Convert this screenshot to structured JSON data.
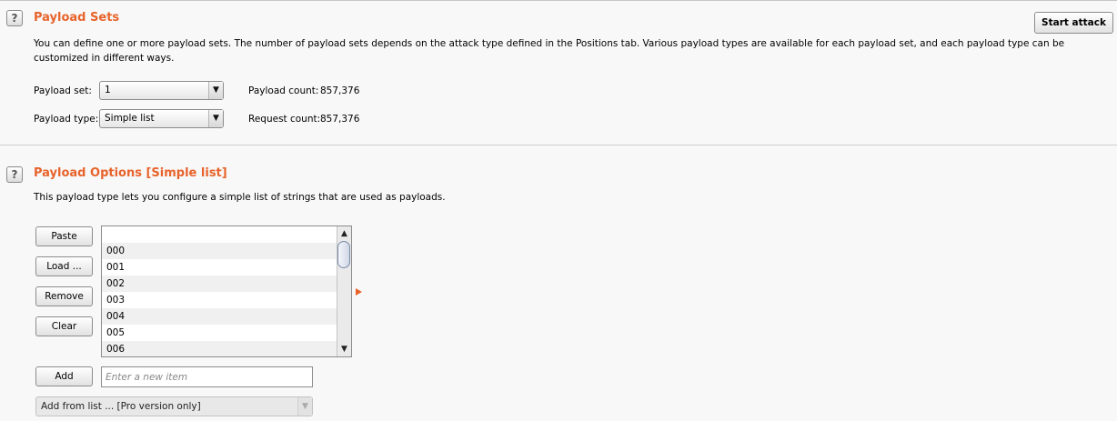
{
  "payload_sets": {
    "title": "Payload Sets",
    "help_icon": "?",
    "description_line1": "You can define one or more payload sets. The number of payload sets depends on the attack type defined in the Positions tab. Various payload types are available for each payload set, and each payload type can be",
    "description_line2": "customized in different ways.",
    "payload_set_label": "Payload set:",
    "payload_set_value": "1",
    "payload_type_label": "Payload type:",
    "payload_type_value": "Simple list",
    "payload_count_label": "Payload count:",
    "payload_count_value": "857,376",
    "request_count_label": "Request count:",
    "request_count_value": "857,376",
    "start_attack_label": "Start attack"
  },
  "payload_options": {
    "title": "Payload Options [Simple list]",
    "help_icon": "?",
    "description": "This payload type lets you configure a simple list of strings that are used as payloads.",
    "buttons": {
      "paste": "Paste",
      "load": "Load ...",
      "remove": "Remove",
      "clear": "Clear",
      "add": "Add"
    },
    "list_items": [
      "",
      "000",
      "001",
      "002",
      "003",
      "004",
      "005",
      "006"
    ],
    "new_item_placeholder": "Enter a new item",
    "add_from_list_value": "Add from list ... [Pro version only]"
  },
  "icons": {
    "dropdown_arrow": "▼",
    "scroll_up": "▲",
    "scroll_down": "▼"
  },
  "colors": {
    "accent": "#e8632b",
    "background": "#f8f8f8"
  }
}
